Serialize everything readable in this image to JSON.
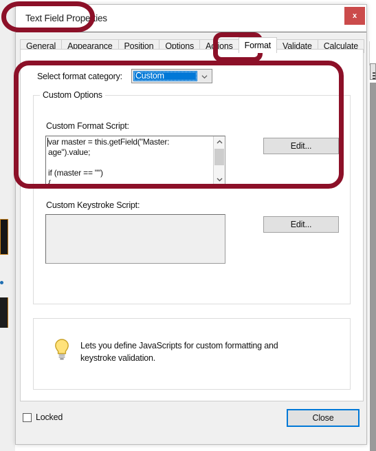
{
  "window": {
    "title": "Text Field Properties",
    "close_icon_label": "x"
  },
  "tabs": [
    {
      "label": "General",
      "active": false
    },
    {
      "label": "Appearance",
      "active": false
    },
    {
      "label": "Position",
      "active": false
    },
    {
      "label": "Options",
      "active": false
    },
    {
      "label": "Actions",
      "active": false
    },
    {
      "label": "Format",
      "active": true
    },
    {
      "label": "Validate",
      "active": false
    },
    {
      "label": "Calculate",
      "active": false
    }
  ],
  "format_tab": {
    "category_label": "Select format category:",
    "category_value": "Custom",
    "group_legend": "Custom Options",
    "format_script_label": "Custom Format Script:",
    "format_script_value": "var master = this.getField(\"Master: age\").value;\n\nif (master == \"\")\n{",
    "format_edit_button": "Edit...",
    "keystroke_script_label": "Custom Keystroke Script:",
    "keystroke_script_value": "",
    "keystroke_edit_button": "Edit..."
  },
  "hint": {
    "icon": "lightbulb-icon",
    "text": "Lets you define JavaScripts for custom formatting and keystroke validation."
  },
  "footer": {
    "locked_label": "Locked",
    "locked_checked": false,
    "close_label": "Close"
  },
  "colors": {
    "annotation_red": "#8c1028",
    "selection_blue": "#0078d7",
    "close_button_red": "#cb4b4b",
    "dialog_bg": "#f0f0f0"
  }
}
